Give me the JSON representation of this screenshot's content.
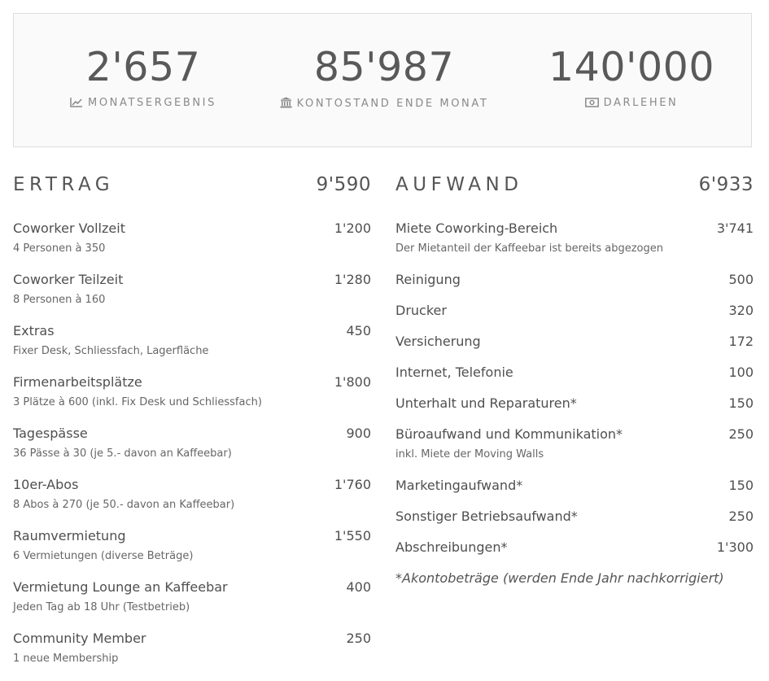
{
  "stats": [
    {
      "value": "2'657",
      "label": "MONATSERGEBNIS",
      "icon": "line-chart-icon"
    },
    {
      "value": "85'987",
      "label": "KONTOSTAND ENDE MONAT",
      "icon": "bank-icon"
    },
    {
      "value": "140'000",
      "label": "DARLEHEN",
      "icon": "money-icon"
    }
  ],
  "ertrag": {
    "title": "ERTRAG",
    "total": "9'590",
    "items": [
      {
        "label": "Coworker Vollzeit",
        "amount": "1'200",
        "sub": "4 Personen à 350"
      },
      {
        "label": "Coworker Teilzeit",
        "amount": "1'280",
        "sub": "8 Personen à 160"
      },
      {
        "label": "Extras",
        "amount": "450",
        "sub": "Fixer Desk, Schliessfach, Lagerfläche"
      },
      {
        "label": "Firmenarbeitsplätze",
        "amount": "1'800",
        "sub": "3 Plätze à 600 (inkl. Fix Desk und Schliessfach)"
      },
      {
        "label": "Tagespässe",
        "amount": "900",
        "sub": "36 Pässe à 30 (je 5.- davon an Kaffeebar)"
      },
      {
        "label": "10er-Abos",
        "amount": "1'760",
        "sub": "8 Abos à 270 (je 50.- davon an Kaffeebar)"
      },
      {
        "label": "Raumvermietung",
        "amount": "1'550",
        "sub": "6 Vermietungen (diverse Beträge)"
      },
      {
        "label": "Vermietung Lounge an Kaffeebar",
        "amount": "400",
        "sub": "Jeden Tag ab 18 Uhr (Testbetrieb)"
      },
      {
        "label": "Community Member",
        "amount": "250",
        "sub": "1 neue Membership"
      }
    ]
  },
  "aufwand": {
    "title": "AUFWAND",
    "total": "6'933",
    "items": [
      {
        "label": "Miete Coworking-Bereich",
        "amount": "3'741",
        "sub": "Der Mietanteil der Kaffeebar ist bereits abgezogen"
      },
      {
        "label": "Reinigung",
        "amount": "500"
      },
      {
        "label": "Drucker",
        "amount": "320"
      },
      {
        "label": "Versicherung",
        "amount": "172"
      },
      {
        "label": "Internet, Telefonie",
        "amount": "100"
      },
      {
        "label": "Unterhalt und Reparaturen*",
        "amount": "150"
      },
      {
        "label": "Büroaufwand und Kommunikation*",
        "amount": "250",
        "sub": "inkl. Miete der Moving Walls"
      },
      {
        "label": "Marketingaufwand*",
        "amount": "150"
      },
      {
        "label": "Sonstiger Betriebsaufwand*",
        "amount": "250"
      },
      {
        "label": "Abschreibungen*",
        "amount": "1'300"
      }
    ],
    "footnote": "*Akontobeträge (werden Ende Jahr nachkorrigiert)"
  }
}
